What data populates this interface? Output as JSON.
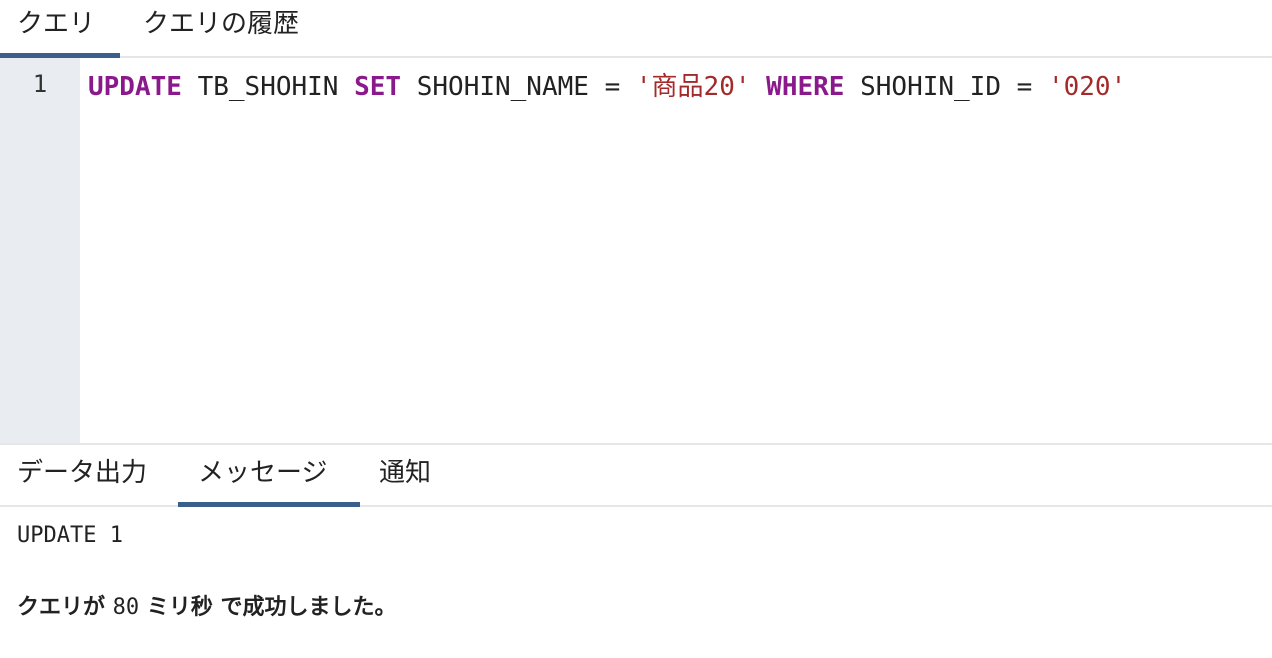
{
  "tabs": {
    "query_label": "クエリ",
    "history_label": "クエリの履歴"
  },
  "editor": {
    "line_number": "1",
    "tokens": {
      "update": "UPDATE",
      "table": " TB_SHOHIN ",
      "set": "SET",
      "column": " SHOHIN_NAME = ",
      "value1": "'商品20'",
      "space": " ",
      "where": "WHERE",
      "condition": " SHOHIN_ID = ",
      "value2": "'020'"
    }
  },
  "result_tabs": {
    "data_output_label": "データ出力",
    "messages_label": "メッセージ",
    "notifications_label": "通知"
  },
  "messages": {
    "result_line": "UPDATE 1",
    "success_prefix": "クエリが ",
    "duration": "80",
    "success_suffix": " ミリ秒 で成功しました。"
  },
  "colors": {
    "keyword": "#8a1a8c",
    "string": "#a32a2a",
    "active_tab_underline": "#3a5f8c",
    "gutter_background": "#e9edf2"
  }
}
